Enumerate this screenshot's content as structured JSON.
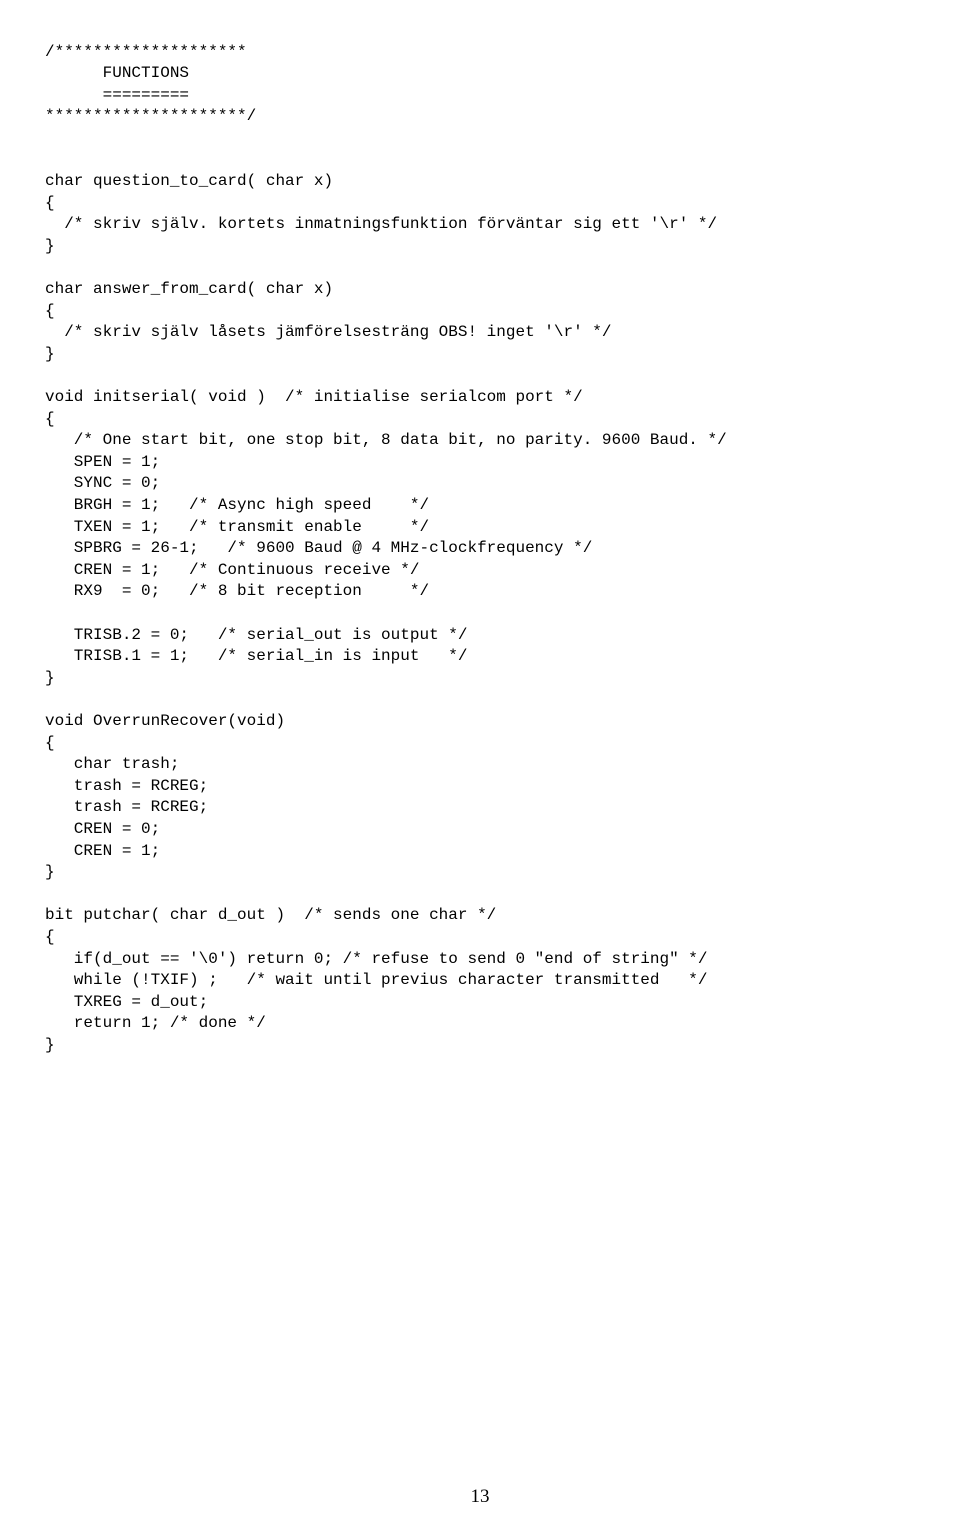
{
  "code": {
    "l1": "/********************",
    "l2": "      FUNCTIONS",
    "l3": "      =========",
    "l4": "*********************/",
    "l5": "",
    "l6": "",
    "l7": "char question_to_card( char x)",
    "l8": "{",
    "l9": "  /* skriv själv. kortets inmatningsfunktion förväntar sig ett '\\r' */",
    "l10": "}",
    "l11": "",
    "l12": "char answer_from_card( char x)",
    "l13": "{",
    "l14": "  /* skriv själv låsets jämförelsesträng OBS! inget '\\r' */",
    "l15": "}",
    "l16": "",
    "l17": "void initserial( void )  /* initialise serialcom port */",
    "l18": "{",
    "l19": "   /* One start bit, one stop bit, 8 data bit, no parity. 9600 Baud. */",
    "l20": "   SPEN = 1;",
    "l21": "   SYNC = 0;",
    "l22": "   BRGH = 1;   /* Async high speed    */",
    "l23": "   TXEN = 1;   /* transmit enable     */",
    "l24": "   SPBRG = 26-1;   /* 9600 Baud @ 4 MHz-clockfrequency */",
    "l25": "   CREN = 1;   /* Continuous receive */",
    "l26": "   RX9  = 0;   /* 8 bit reception     */",
    "l27": "",
    "l28": "   TRISB.2 = 0;   /* serial_out is output */",
    "l29": "   TRISB.1 = 1;   /* serial_in is input   */",
    "l30": "}",
    "l31": "",
    "l32": "void OverrunRecover(void)",
    "l33": "{",
    "l34": "   char trash;",
    "l35": "   trash = RCREG;",
    "l36": "   trash = RCREG;",
    "l37": "   CREN = 0;",
    "l38": "   CREN = 1;",
    "l39": "}",
    "l40": "",
    "l41": "bit putchar( char d_out )  /* sends one char */",
    "l42": "{",
    "l43": "   if(d_out == '\\0') return 0; /* refuse to send 0 \"end of string\" */",
    "l44": "   while (!TXIF) ;   /* wait until previus character transmitted   */",
    "l45": "   TXREG = d_out;",
    "l46": "   return 1; /* done */",
    "l47": "}"
  },
  "pageNumber": "13"
}
